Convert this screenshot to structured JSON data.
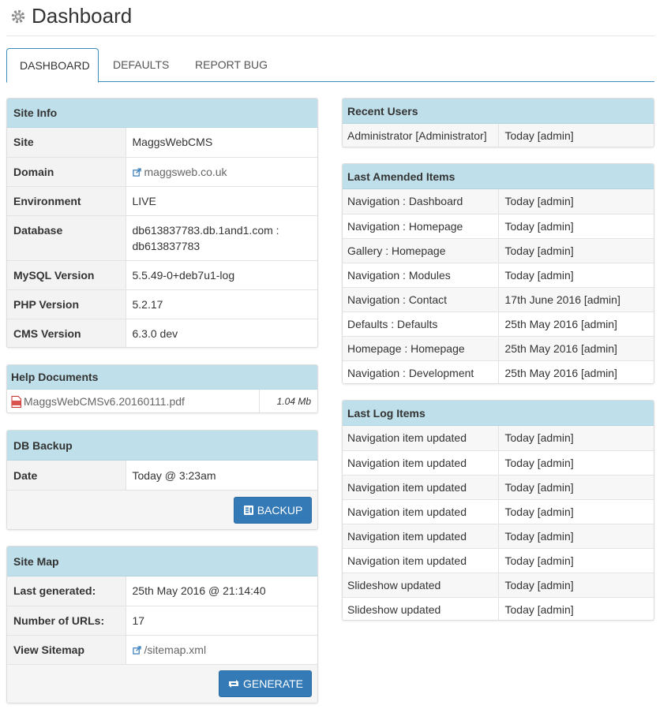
{
  "header": {
    "title": "Dashboard"
  },
  "tabs": [
    {
      "label": "DASHBOARD"
    },
    {
      "label": "DEFAULTS"
    },
    {
      "label": "REPORT BUG"
    }
  ],
  "site_info": {
    "heading": "Site Info",
    "rows": [
      {
        "key": "Site",
        "value": "MaggsWebCMS"
      },
      {
        "key": "Domain",
        "value": "maggsweb.co.uk"
      },
      {
        "key": "Environment",
        "value": "LIVE"
      },
      {
        "key": "Database",
        "value": "db613837783.db.1and1.com :",
        "value2": "db613837783"
      },
      {
        "key": "MySQL Version",
        "value": "5.5.49-0+deb7u1-log"
      },
      {
        "key": "PHP Version",
        "value": "5.2.17"
      },
      {
        "key": "CMS Version",
        "value": "6.3.0 dev"
      }
    ]
  },
  "help_documents": {
    "heading": "Help Documents",
    "file": {
      "name": "MaggsWebCMSv6.20160111.pdf",
      "size": "1.04 Mb"
    }
  },
  "db_backup": {
    "heading": "DB Backup",
    "date_label": "Date",
    "date_value": "Today @ 3:23am",
    "button_label": "BACKUP"
  },
  "site_map": {
    "heading": "Site Map",
    "rows": [
      {
        "key": "Last generated:",
        "value": "25th May 2016 @ 21:14:40"
      },
      {
        "key": "Number of URLs:",
        "value": "17"
      },
      {
        "key": "View Sitemap",
        "value": "/sitemap.xml"
      }
    ],
    "button_label": "GENERATE"
  },
  "recent_users": {
    "heading": "Recent Users",
    "rows": [
      {
        "name": "Administrator [Administrator]",
        "when": "Today [admin]"
      }
    ]
  },
  "last_amended": {
    "heading": "Last Amended Items",
    "rows": [
      {
        "item": "Navigation : Dashboard",
        "when": "Today [admin]"
      },
      {
        "item": "Navigation : Homepage",
        "when": "Today [admin]"
      },
      {
        "item": "Gallery : Homepage",
        "when": "Today [admin]"
      },
      {
        "item": "Navigation : Modules",
        "when": "Today [admin]"
      },
      {
        "item": "Navigation : Contact",
        "when": "17th June 2016 [admin]"
      },
      {
        "item": "Defaults : Defaults",
        "when": "25th May 2016 [admin]"
      },
      {
        "item": "Homepage : Homepage",
        "when": "25th May 2016 [admin]"
      },
      {
        "item": "Navigation : Development",
        "when": "25th May 2016 [admin]"
      }
    ]
  },
  "last_log": {
    "heading": "Last Log Items",
    "rows": [
      {
        "item": "Navigation item updated",
        "when": "Today [admin]"
      },
      {
        "item": "Navigation item updated",
        "when": "Today [admin]"
      },
      {
        "item": "Navigation item updated",
        "when": "Today [admin]"
      },
      {
        "item": "Navigation item updated",
        "when": "Today [admin]"
      },
      {
        "item": "Navigation item updated",
        "when": "Today [admin]"
      },
      {
        "item": "Navigation item updated",
        "when": "Today [admin]"
      },
      {
        "item": "Slideshow updated",
        "when": "Today [admin]"
      },
      {
        "item": "Slideshow updated",
        "when": "Today [admin]"
      }
    ]
  },
  "icons": {
    "header": "gear-icon",
    "link": "external-link-icon",
    "pdf": "pdf-file-icon",
    "backup": "database-icon",
    "generate": "refresh-icon"
  },
  "colors": {
    "accent": "#3c8dbc",
    "panel_heading": "#bfe0ea",
    "button": "#337ab7"
  }
}
